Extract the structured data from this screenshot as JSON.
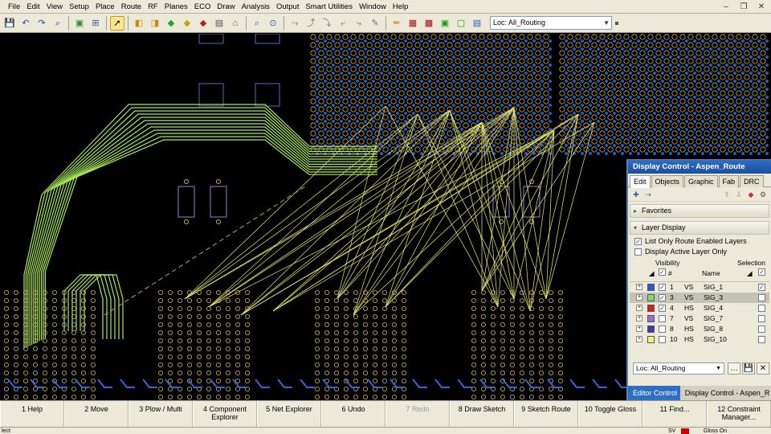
{
  "menu": {
    "items": [
      "File",
      "Edit",
      "View",
      "Setup",
      "Place",
      "Route",
      "RF",
      "Planes",
      "ECO",
      "Draw",
      "Analysis",
      "Output",
      "Smart Utilities",
      "Window",
      "Help"
    ]
  },
  "window_controls": {
    "minimize": "–",
    "restore": "❐",
    "close": "✕"
  },
  "toolbar": {
    "location": "Loc: All_Routing"
  },
  "display_control": {
    "title": "Display Control - Aspen_Route",
    "tabs": [
      "Edit",
      "Objects",
      "Graphic",
      "Fab",
      "DRC"
    ],
    "favorites_label": "Favorites",
    "layer_display_label": "Layer Display",
    "option_route_enabled": "List Only Route Enabled Layers",
    "option_active_only": "Display Active Layer Only",
    "col_visibility": "Visibility",
    "col_selection": "Selection",
    "col_num": "#",
    "col_name": "Name",
    "layers": [
      {
        "num": "1",
        "dir": "VS",
        "name": "SIG_1",
        "color": "#1f5fd6",
        "visible": "✓",
        "selected": "✓"
      },
      {
        "num": "3",
        "dir": "VS",
        "name": "SIG_3",
        "color": "#7fdc6a",
        "visible": "✓",
        "selected": ""
      },
      {
        "num": "4",
        "dir": "HS",
        "name": "SIG_4",
        "color": "#d42020",
        "visible": "✓",
        "selected": ""
      },
      {
        "num": "7",
        "dir": "VS",
        "name": "SIG_7",
        "color": "#9a6ad8",
        "visible": "",
        "selected": ""
      },
      {
        "num": "8",
        "dir": "HS",
        "name": "SIG_8",
        "color": "#3a3ab8",
        "visible": "",
        "selected": ""
      },
      {
        "num": "10",
        "dir": "HS",
        "name": "SIG_10",
        "color": "#f0f07a",
        "visible": "",
        "selected": ""
      }
    ],
    "location": "Loc: All_Routing",
    "bottom_tabs": [
      "Editor Control",
      "Display Control - Aspen_R"
    ]
  },
  "fkeys": [
    "1 Help",
    "2 Move",
    "3 Plow / Multi",
    "4 Component\nExplorer",
    "5 Net Explorer",
    "6 Undo",
    "7 Redo",
    "8 Draw Sketch",
    "9 Sketch Route",
    "10 Toggle Gloss",
    "11 Find...",
    "12 Constraint\nManager..."
  ],
  "status": {
    "left": "lect",
    "sv": "SV",
    "gloss": "Gloss On"
  },
  "colors": {
    "trace_green": "#a8e85a",
    "ratsnest_yellow": "#e8e870",
    "via_blue": "#2255dd",
    "pad_outline": "#d2b45a",
    "outline_purple": "#6a60c8"
  }
}
